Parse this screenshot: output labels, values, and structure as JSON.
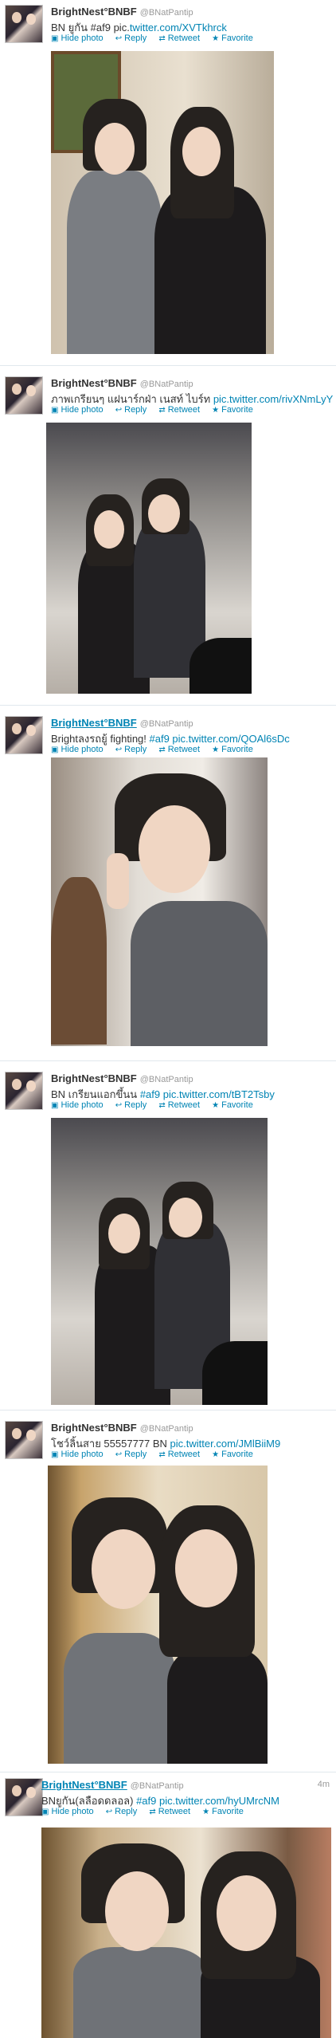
{
  "tweets": [
    {
      "name": "BrightNest°BNBF",
      "handle": "@BNatPantip",
      "text_prefix": "BN ยูกัน #af9 pic.",
      "text_link": "twitter.com/XVTkhrck",
      "hide": "Hide photo",
      "reply": "Reply",
      "retweet": "Retweet",
      "favorite": "Favorite",
      "time": ""
    },
    {
      "name": "BrightNest°BNBF",
      "handle": "@BNatPantip",
      "text_prefix": "ภาพเกรียนๆ แฝนาร์กฝ่า เนสท์ ไบร์ท ",
      "text_link": "pic.twitter.com/rivXNmLyY",
      "hide": "Hide photo",
      "reply": "Reply",
      "retweet": "Retweet",
      "favorite": "Favorite",
      "time": ""
    },
    {
      "name": "BrightNest°BNBF",
      "handle": "@BNatPantip",
      "text_prefix": "Brightลงรถยู้ fighting! ",
      "text_link": "#af9 pic.twitter.com/QOAl6sDc",
      "hide": "Hide photo",
      "reply": "Reply",
      "retweet": "Retweet",
      "favorite": "Favorite",
      "time": ""
    },
    {
      "name": "BrightNest°BNBF",
      "handle": "@BNatPantip",
      "text_prefix": "BN เกรียนแอกขึ้นน ",
      "text_link": "#af9 pic.twitter.com/tBT2Tsby",
      "hide": "Hide photo",
      "reply": "Reply",
      "retweet": "Retweet",
      "favorite": "Favorite",
      "time": ""
    },
    {
      "name": "BrightNest°BNBF",
      "handle": "@BNatPantip",
      "text_prefix": "โชว์ลิ้นสาย 55557777 BN ",
      "text_link": "pic.twitter.com/JMlBiiM9",
      "hide": "Hide photo",
      "reply": "Reply",
      "retweet": "Retweet",
      "favorite": "Favorite",
      "time": ""
    },
    {
      "name": "BrightNest°BNBF",
      "handle": "@BNatPantip",
      "text_prefix": "BNยูกัน(ลลือดดลอล) ",
      "text_link": "#af9 pic.twitter.com/hyUMrcNM",
      "hide": "Hide photo",
      "reply": "Reply",
      "retweet": "Retweet",
      "favorite": "Favorite",
      "time": "4m"
    }
  ],
  "colors": {
    "link": "#0084b4",
    "text": "#333333",
    "muted": "#999999"
  },
  "icons": [
    "photo-icon",
    "reply-icon",
    "retweet-icon",
    "star-icon"
  ]
}
